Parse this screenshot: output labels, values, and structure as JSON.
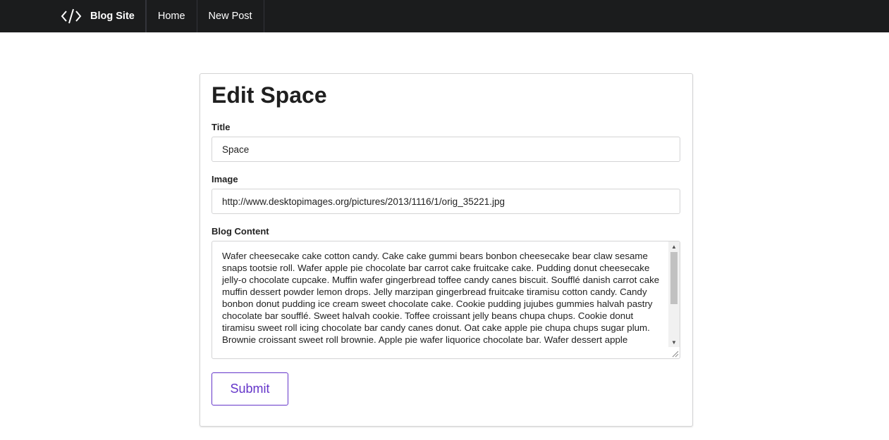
{
  "navbar": {
    "brand": "Blog Site",
    "brand_icon": "code-icon",
    "links": [
      "Home",
      "New Post"
    ],
    "background": "#1b1c1d"
  },
  "form": {
    "heading": "Edit Space",
    "title_label": "Title",
    "title_value": "Space",
    "image_label": "Image",
    "image_value": "http://www.desktopimages.org/pictures/2013/1116/1/orig_35221.jpg",
    "content_label": "Blog Content",
    "content_value": "Wafer cheesecake cake cotton candy. Cake cake gummi bears bonbon cheesecake bear claw sesame snaps tootsie roll. Wafer apple pie chocolate bar carrot cake fruitcake cake. Pudding donut cheesecake jelly-o chocolate cupcake. Muffin wafer gingerbread toffee candy canes biscuit. Soufflé danish carrot cake muffin dessert powder lemon drops. Jelly marzipan gingerbread fruitcake tiramisu cotton candy. Candy bonbon donut pudding ice cream sweet chocolate cake. Cookie pudding jujubes gummies halvah pastry chocolate bar soufflé. Sweet halvah cookie. Toffee croissant jelly beans chupa chups. Cookie donut tiramisu sweet roll icing chocolate bar candy canes donut. Oat cake apple pie chupa chups sugar plum.\nBrownie croissant sweet roll brownie. Apple pie wafer liquorice chocolate bar. Wafer dessert apple",
    "submit_label": "Submit",
    "accent_color": "#6435c9"
  }
}
